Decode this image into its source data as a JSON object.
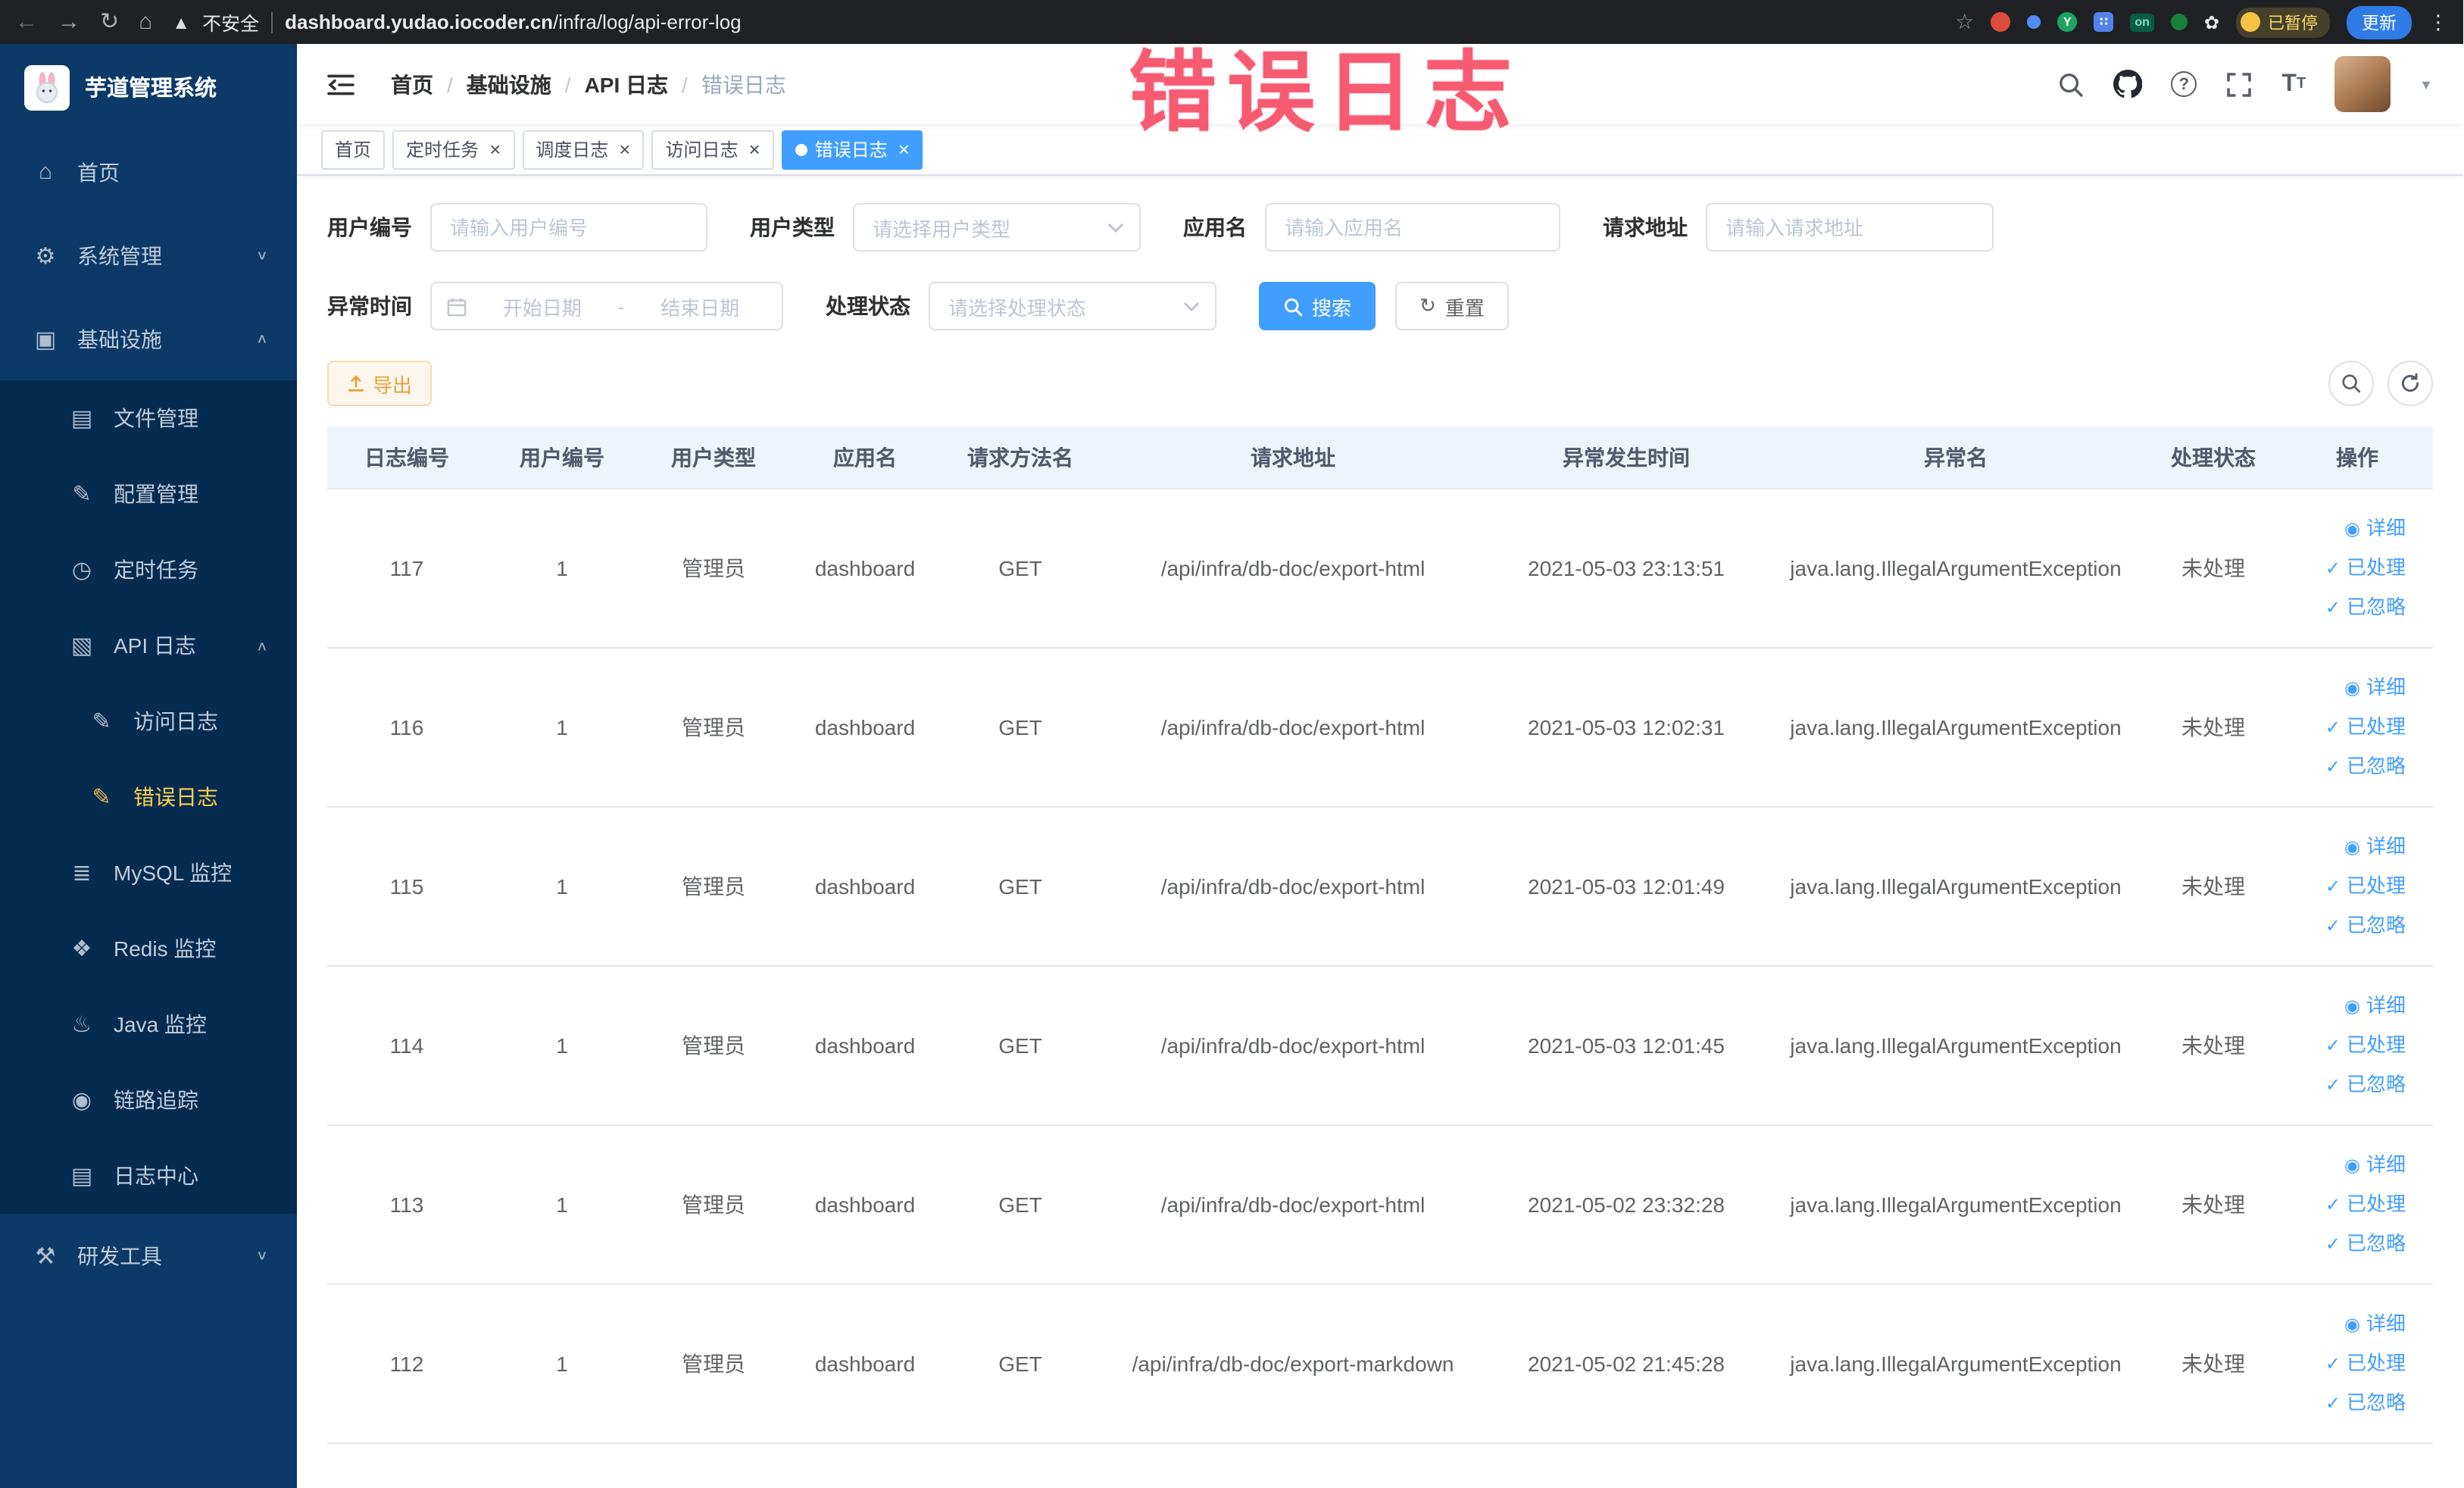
{
  "overlay": {
    "text": "错误日志"
  },
  "browser": {
    "security_warning": "不安全",
    "url_domain": "dashboard.yudao.iocoder.cn",
    "url_path": "/infra/log/api-error-log",
    "ext_on_badge": "on",
    "paused_badge": "已暂停",
    "update_button": "更新"
  },
  "sidebar": {
    "app_title": "芋道管理系统",
    "items": [
      {
        "name": "home",
        "label": "首页",
        "icon": "home-icon",
        "level": 1
      },
      {
        "name": "system-management",
        "label": "系统管理",
        "icon": "gear-icon",
        "level": 1,
        "chevron": "down"
      },
      {
        "name": "infrastructure",
        "label": "基础设施",
        "icon": "infrastructure-icon",
        "level": 1,
        "chevron": "up"
      },
      {
        "name": "file-management",
        "label": "文件管理",
        "icon": "file-icon",
        "level": 2
      },
      {
        "name": "config-management",
        "label": "配置管理",
        "icon": "config-icon",
        "level": 2
      },
      {
        "name": "scheduled-tasks",
        "label": "定时任务",
        "icon": "schedule-icon",
        "level": 2
      },
      {
        "name": "api-log",
        "label": "API 日志",
        "icon": "api-log-icon",
        "level": 2,
        "chevron": "up"
      },
      {
        "name": "access-log",
        "label": "访问日志",
        "icon": "access-log-icon",
        "level": 3
      },
      {
        "name": "error-log",
        "label": "错误日志",
        "icon": "error-log-icon",
        "level": 3,
        "active": true
      },
      {
        "name": "mysql-monitor",
        "label": "MySQL 监控",
        "icon": "mysql-icon",
        "level": 2
      },
      {
        "name": "redis-monitor",
        "label": "Redis 监控",
        "icon": "redis-icon",
        "level": 2
      },
      {
        "name": "java-monitor",
        "label": "Java 监控",
        "icon": "java-icon",
        "level": 2
      },
      {
        "name": "link-trace",
        "label": "链路追踪",
        "icon": "trace-icon",
        "level": 2
      },
      {
        "name": "log-center",
        "label": "日志中心",
        "icon": "log-center-icon",
        "level": 2
      },
      {
        "name": "dev-tools",
        "label": "研发工具",
        "icon": "devtools-icon",
        "level": 1,
        "chevron": "down"
      }
    ]
  },
  "header": {
    "breadcrumb": [
      "首页",
      "基础设施",
      "API 日志",
      "错误日志"
    ]
  },
  "tabs": [
    {
      "name": "home",
      "label": "首页",
      "closable": false,
      "active": false
    },
    {
      "name": "scheduled-tasks",
      "label": "定时任务",
      "closable": true,
      "active": false
    },
    {
      "name": "schedule-log",
      "label": "调度日志",
      "closable": true,
      "active": false
    },
    {
      "name": "access-log",
      "label": "访问日志",
      "closable": true,
      "active": false
    },
    {
      "name": "error-log",
      "label": "错误日志",
      "closable": true,
      "active": true
    }
  ],
  "filters": {
    "user_id": {
      "label": "用户编号",
      "placeholder": "请输入用户编号"
    },
    "user_type": {
      "label": "用户类型",
      "placeholder": "请选择用户类型"
    },
    "app_name": {
      "label": "应用名",
      "placeholder": "请输入应用名"
    },
    "request_url": {
      "label": "请求地址",
      "placeholder": "请输入请求地址"
    },
    "exception_time": {
      "label": "异常时间",
      "start_placeholder": "开始日期",
      "separator": "-",
      "end_placeholder": "结束日期"
    },
    "process_status": {
      "label": "处理状态",
      "placeholder": "请选择处理状态"
    },
    "search_button": "搜索",
    "reset_button": "重置"
  },
  "toolbar": {
    "export_button": "导出"
  },
  "table": {
    "columns": [
      "日志编号",
      "用户编号",
      "用户类型",
      "应用名",
      "请求方法名",
      "请求地址",
      "异常发生时间",
      "异常名",
      "处理状态",
      "操作"
    ],
    "row_actions": [
      {
        "name": "detail",
        "label": "详细",
        "icon": "eye-icon"
      },
      {
        "name": "processed",
        "label": "已处理",
        "icon": "check-icon"
      },
      {
        "name": "ignored",
        "label": "已忽略",
        "icon": "check-icon"
      }
    ],
    "rows": [
      {
        "id": "117",
        "user_id": "1",
        "user_type": "管理员",
        "app": "dashboard",
        "method": "GET",
        "url": "/api/infra/db-doc/export-html",
        "time": "2021-05-03 23:13:51",
        "exception": "java.lang.IllegalArgumentException",
        "status": "未处理"
      },
      {
        "id": "116",
        "user_id": "1",
        "user_type": "管理员",
        "app": "dashboard",
        "method": "GET",
        "url": "/api/infra/db-doc/export-html",
        "time": "2021-05-03 12:02:31",
        "exception": "java.lang.IllegalArgumentException",
        "status": "未处理"
      },
      {
        "id": "115",
        "user_id": "1",
        "user_type": "管理员",
        "app": "dashboard",
        "method": "GET",
        "url": "/api/infra/db-doc/export-html",
        "time": "2021-05-03 12:01:49",
        "exception": "java.lang.IllegalArgumentException",
        "status": "未处理"
      },
      {
        "id": "114",
        "user_id": "1",
        "user_type": "管理员",
        "app": "dashboard",
        "method": "GET",
        "url": "/api/infra/db-doc/export-html",
        "time": "2021-05-03 12:01:45",
        "exception": "java.lang.IllegalArgumentException",
        "status": "未处理"
      },
      {
        "id": "113",
        "user_id": "1",
        "user_type": "管理员",
        "app": "dashboard",
        "method": "GET",
        "url": "/api/infra/db-doc/export-html",
        "time": "2021-05-02 23:32:28",
        "exception": "java.lang.IllegalArgumentException",
        "status": "未处理"
      },
      {
        "id": "112",
        "user_id": "1",
        "user_type": "管理员",
        "app": "dashboard",
        "method": "GET",
        "url": "/api/infra/db-doc/export-markdown",
        "time": "2021-05-02 21:45:28",
        "exception": "java.lang.IllegalArgumentException",
        "status": "未处理"
      }
    ]
  },
  "colors": {
    "accent": "#409eff",
    "sidebar_bg": "#0b3a68",
    "sidebar_submenu_bg": "#062b50",
    "sidebar_active_text": "#ffd04b",
    "warning_button_text": "#e6a23c",
    "annotation_red": "#f5455f"
  }
}
